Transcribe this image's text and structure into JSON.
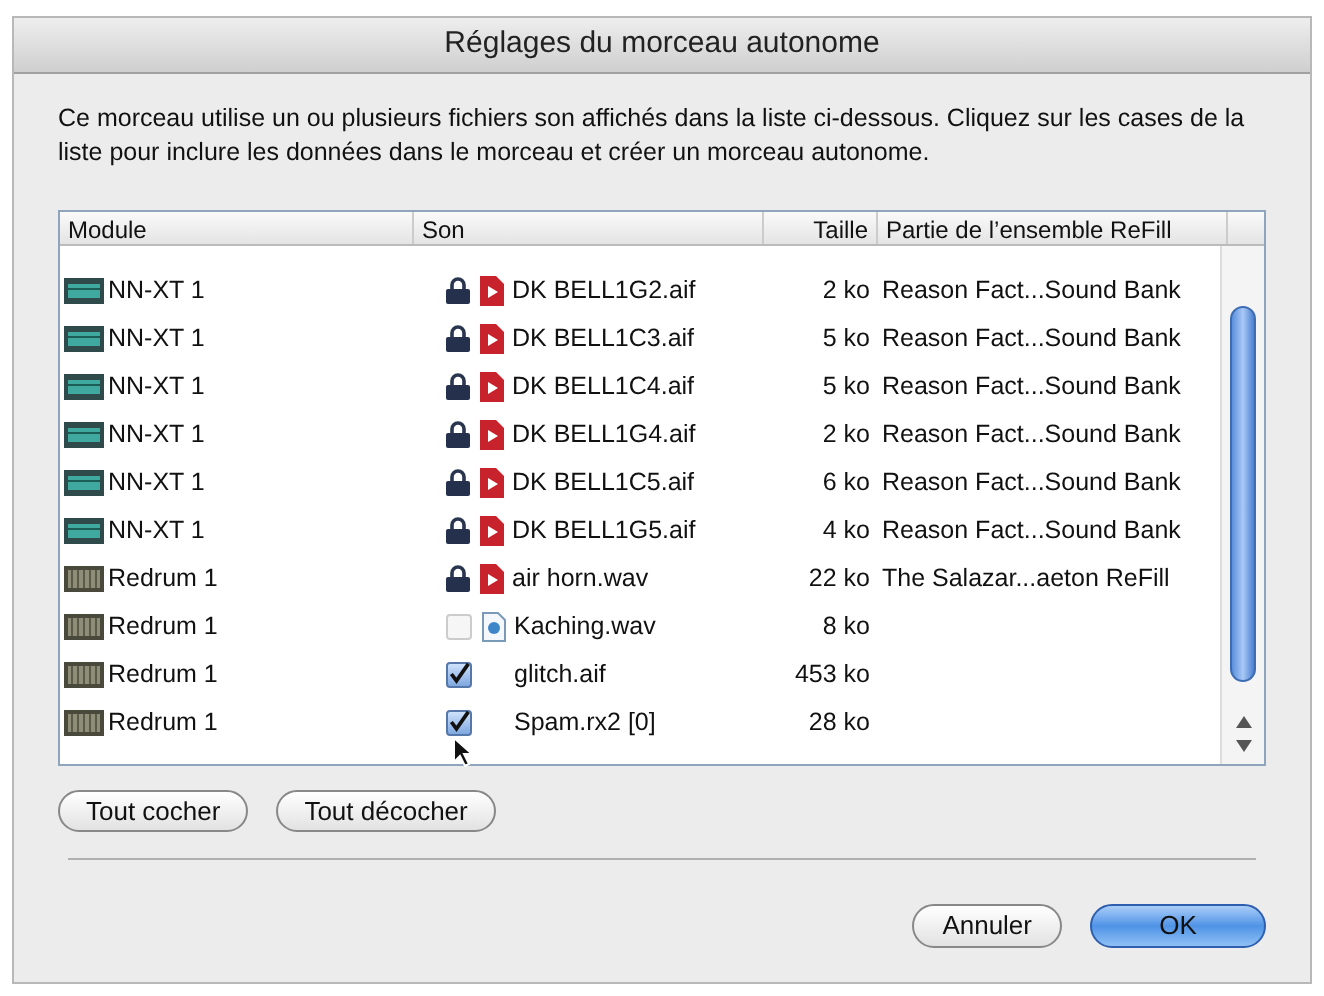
{
  "window": {
    "title": "Réglages du morceau autonome"
  },
  "description": "Ce morceau utilise un ou plusieurs fichiers son affichés dans la liste ci-dessous. Cliquez sur les cases de la liste pour inclure les données dans le morceau et créer un morceau autonome.",
  "table": {
    "columns": [
      "Module",
      "Son",
      "Taille",
      "Partie de l’ensemble ReFill"
    ],
    "rows": [
      {
        "kind": "locked",
        "module": {
          "name": "NN-XT 1",
          "kind": "sampler"
        },
        "sound": {
          "name": "DK BELL1G2.aif",
          "kind": "sample"
        },
        "size": "2 ko",
        "refill": "Reason Fact...Sound Bank"
      },
      {
        "kind": "locked",
        "module": {
          "name": "NN-XT 1",
          "kind": "sampler"
        },
        "sound": {
          "name": "DK BELL1C3.aif",
          "kind": "sample"
        },
        "size": "5 ko",
        "refill": "Reason Fact...Sound Bank"
      },
      {
        "kind": "locked",
        "module": {
          "name": "NN-XT 1",
          "kind": "sampler"
        },
        "sound": {
          "name": "DK BELL1C4.aif",
          "kind": "sample"
        },
        "size": "5 ko",
        "refill": "Reason Fact...Sound Bank"
      },
      {
        "kind": "locked",
        "module": {
          "name": "NN-XT 1",
          "kind": "sampler"
        },
        "sound": {
          "name": "DK BELL1G4.aif",
          "kind": "sample"
        },
        "size": "2 ko",
        "refill": "Reason Fact...Sound Bank"
      },
      {
        "kind": "locked",
        "module": {
          "name": "NN-XT 1",
          "kind": "sampler"
        },
        "sound": {
          "name": "DK BELL1C5.aif",
          "kind": "sample"
        },
        "size": "6 ko",
        "refill": "Reason Fact...Sound Bank"
      },
      {
        "kind": "locked",
        "module": {
          "name": "NN-XT 1",
          "kind": "sampler"
        },
        "sound": {
          "name": "DK BELL1G5.aif",
          "kind": "sample"
        },
        "size": "4 ko",
        "refill": "Reason Fact...Sound Bank"
      },
      {
        "kind": "locked",
        "module": {
          "name": "Redrum 1",
          "kind": "drum"
        },
        "sound": {
          "name": "air horn.wav",
          "kind": "sample"
        },
        "size": "22 ko",
        "refill": "The Salazar...aeton ReFill"
      },
      {
        "kind": "checkbox",
        "checked": false,
        "disabled": true,
        "module": {
          "name": "Redrum 1",
          "kind": "drum"
        },
        "sound": {
          "name": "Kaching.wav",
          "kind": "document"
        },
        "size": "8 ko"
      },
      {
        "kind": "checkbox",
        "checked": true,
        "disabled": false,
        "module": {
          "name": "Redrum 1",
          "kind": "drum"
        },
        "sound": {
          "name": "glitch.aif",
          "kind": "plain"
        },
        "size": "453 ko"
      },
      {
        "kind": "checkbox",
        "checked": true,
        "disabled": false,
        "module": {
          "name": "Redrum 1",
          "kind": "drum"
        },
        "sound": {
          "name": "Spam.rx2 [0]",
          "kind": "plain"
        },
        "size": "28 ko"
      }
    ]
  },
  "list_buttons": [
    "Tout cocher",
    "Tout décocher"
  ],
  "dialog_buttons": [
    {
      "label": "Annuler",
      "default": false
    },
    {
      "label": "OK",
      "default": true
    }
  ]
}
